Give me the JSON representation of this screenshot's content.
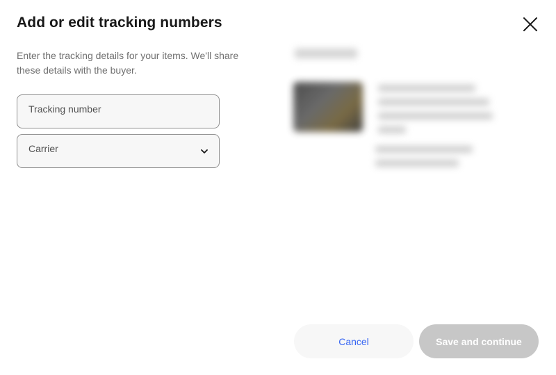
{
  "dialog": {
    "title": "Add or edit tracking numbers",
    "description": "Enter the tracking details for your items. We'll share these details with the buyer.",
    "close_icon": "close-icon"
  },
  "form": {
    "tracking_label": "Tracking number",
    "tracking_value": "",
    "carrier_label": "Carrier",
    "carrier_value": "",
    "carrier_icon": "chevron-down-icon"
  },
  "footer": {
    "cancel_label": "Cancel",
    "save_label": "Save and continue",
    "save_enabled": false
  },
  "colors": {
    "link_blue": "#3665f3",
    "disabled_button": "#c7c7c7",
    "field_border": "#8f8f8f"
  }
}
